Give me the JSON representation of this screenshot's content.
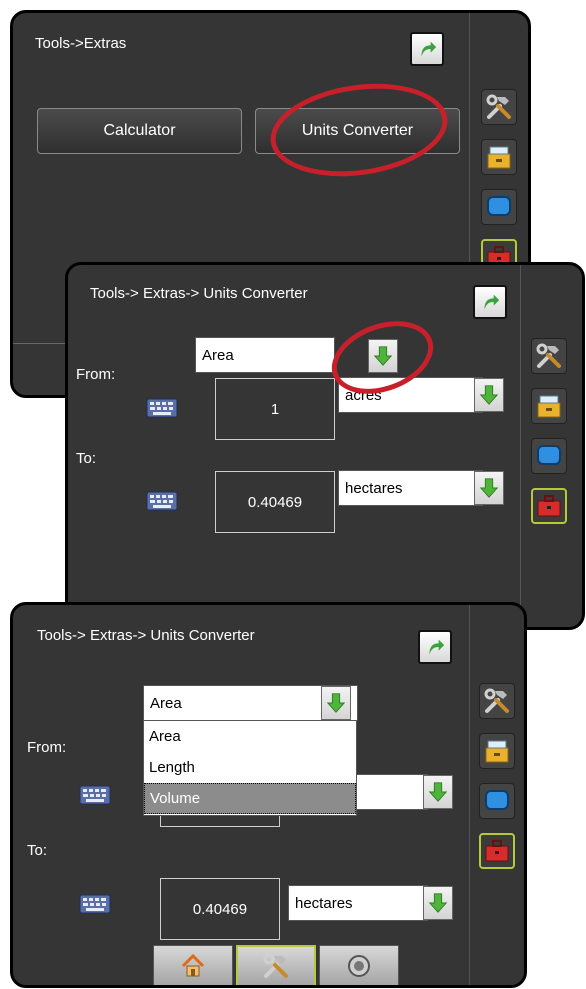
{
  "screen1": {
    "title": "Tools->Extras",
    "buttons": {
      "calculator": "Calculator",
      "units_converter": "Units Converter"
    }
  },
  "screen2": {
    "title": "Tools-> Extras-> Units Converter",
    "category": "Area",
    "from_label": "From:",
    "to_label": "To:",
    "from_value": "1",
    "from_unit": "acres",
    "to_value": "0.40469",
    "to_unit": "hectares"
  },
  "screen3": {
    "title": "Tools-> Extras-> Units Converter",
    "category": "Area",
    "from_label": "From:",
    "to_label": "To:",
    "to_value": "0.40469",
    "to_unit": "hectares",
    "dropdown_options": [
      "Area",
      "Length",
      "Volume"
    ],
    "selected_option": "Volume"
  },
  "icons": {
    "back": "back-arrow-icon",
    "tools": "tools-icon",
    "storage": "storage-icon",
    "console": "console-icon",
    "toolbox": "toolbox-icon",
    "home": "home-icon",
    "guidance": "guidance-icon",
    "keyboard": "keyboard-icon"
  },
  "colors": {
    "highlight_ellipse": "#c8202a",
    "active_border": "#b6c93a",
    "arrow_green": "#4fb53a"
  }
}
